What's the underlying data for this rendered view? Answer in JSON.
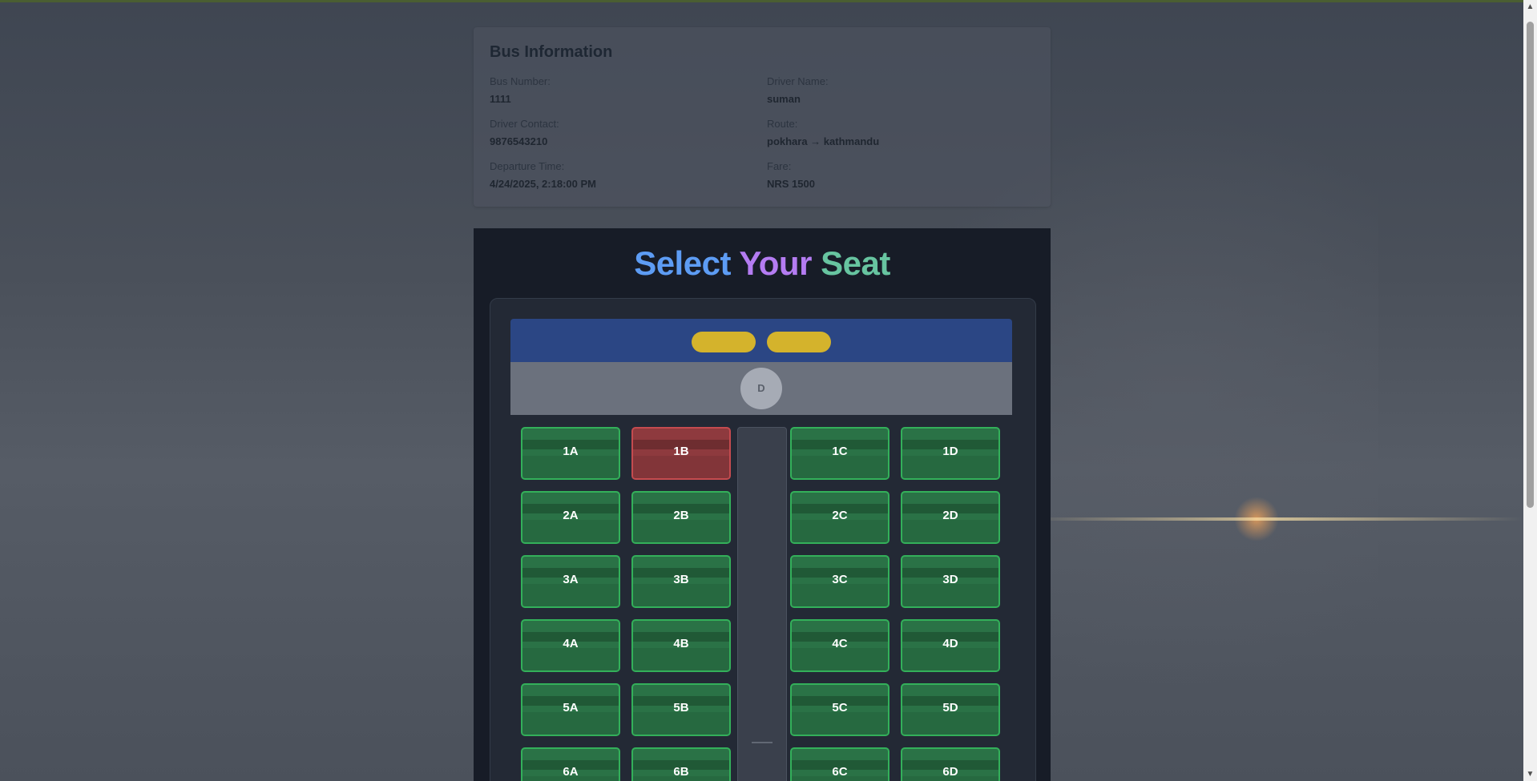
{
  "bus_info": {
    "title": "Bus Information",
    "fields": [
      {
        "label": "Bus Number:",
        "value": "1111"
      },
      {
        "label": "Driver Name:",
        "value": "suman"
      },
      {
        "label": "Driver Contact:",
        "value": "9876543210"
      },
      {
        "label": "Route:",
        "value": "pokhara → kathmandu"
      },
      {
        "label": "Departure Time:",
        "value": "4/24/2025, 2:18:00 PM"
      },
      {
        "label": "Fare:",
        "value": "NRS 1500"
      }
    ]
  },
  "seat_selection": {
    "title_words": [
      "Select",
      "Your",
      "Seat"
    ],
    "driver_label": "D",
    "seats": [
      {
        "id": "1A",
        "status": "available"
      },
      {
        "id": "1B",
        "status": "booked"
      },
      {
        "id": "1C",
        "status": "available"
      },
      {
        "id": "1D",
        "status": "available"
      },
      {
        "id": "2A",
        "status": "available"
      },
      {
        "id": "2B",
        "status": "available"
      },
      {
        "id": "2C",
        "status": "available"
      },
      {
        "id": "2D",
        "status": "available"
      },
      {
        "id": "3A",
        "status": "available"
      },
      {
        "id": "3B",
        "status": "available"
      },
      {
        "id": "3C",
        "status": "available"
      },
      {
        "id": "3D",
        "status": "available"
      },
      {
        "id": "4A",
        "status": "available"
      },
      {
        "id": "4B",
        "status": "available"
      },
      {
        "id": "4C",
        "status": "available"
      },
      {
        "id": "4D",
        "status": "available"
      },
      {
        "id": "5A",
        "status": "available"
      },
      {
        "id": "5B",
        "status": "available"
      },
      {
        "id": "5C",
        "status": "available"
      },
      {
        "id": "5D",
        "status": "available"
      },
      {
        "id": "6A",
        "status": "available"
      },
      {
        "id": "6B",
        "status": "available"
      },
      {
        "id": "6C",
        "status": "available"
      },
      {
        "id": "6D",
        "status": "available"
      }
    ]
  },
  "colors": {
    "available_seat": "#2a7246",
    "booked_seat": "#8e3a3e",
    "bus_front": "#2b4684",
    "headlight": "#d4b32c"
  }
}
